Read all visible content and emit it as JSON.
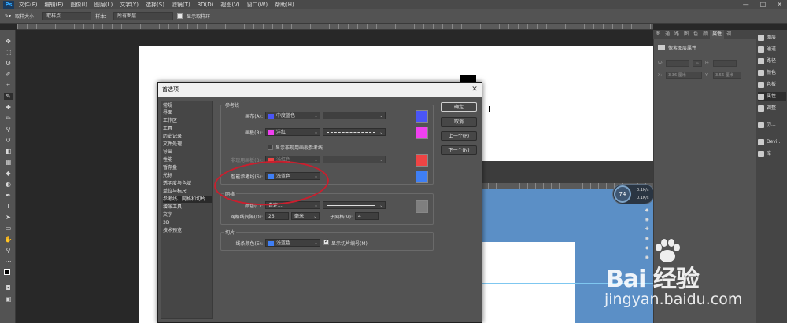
{
  "menubar": {
    "logo": "Ps",
    "items": [
      "文件(F)",
      "编辑(E)",
      "图像(I)",
      "图层(L)",
      "文字(Y)",
      "选择(S)",
      "滤镜(T)",
      "3D(D)",
      "视图(V)",
      "窗口(W)",
      "帮助(H)"
    ],
    "window_controls": [
      "—",
      "□",
      "✕"
    ]
  },
  "options": {
    "sample_size_label": "取样大小：",
    "sample_size_value": "取样点",
    "sample_label": "样本：",
    "sample_value": "所有图层",
    "show_ring_label": "显示取样环"
  },
  "properties_panel": {
    "tabs": [
      "图",
      "通",
      "路",
      "图",
      "色",
      "颜",
      "属性",
      "调"
    ],
    "active_tab": "属性",
    "header": "像素图层属性",
    "w_label": "W:",
    "h_label": "H:",
    "x_label": "X:",
    "y_label": "Y:",
    "x_value": "3.36 厘米",
    "y_value": "3.56 厘米",
    "link_glyph": "∞"
  },
  "dock": {
    "items": [
      {
        "icon": "layers-icon",
        "label": "图层"
      },
      {
        "icon": "channels-icon",
        "label": "通道"
      },
      {
        "icon": "paths-icon",
        "label": "路径"
      },
      {
        "icon": "color-icon",
        "label": "颜色"
      },
      {
        "icon": "swatches-icon",
        "label": "色板"
      },
      {
        "icon": "properties-icon",
        "label": "属性"
      },
      {
        "icon": "adjustments-icon",
        "label": "调整"
      },
      {
        "icon": "history-icon",
        "label": "历..."
      },
      {
        "icon": "device-icon",
        "label": "Devi..."
      },
      {
        "icon": "library-icon",
        "label": "库"
      }
    ]
  },
  "zoom_widget": {
    "value": "74",
    "line1": "0.1K/s",
    "line2": "0.1K/s"
  },
  "dialog": {
    "title": "首选项",
    "close": "✕",
    "categories": [
      "常规",
      "界面",
      "工作区",
      "工具",
      "历史记录",
      "文件处理",
      "导出",
      "性能",
      "暂存盘",
      "光标",
      "透明度与色域",
      "单位与标尺",
      "参考线、网格和切片",
      "增效工具",
      "文字",
      "3D",
      "技术预览"
    ],
    "selected_category": 12,
    "guides": {
      "group_label": "参考线",
      "canvas_label": "画布(A):",
      "canvas_color": "中度蓝色",
      "canvas_swatch": "#4a55f5",
      "artboard_label": "画板(R):",
      "artboard_color": "洋红",
      "artboard_swatch": "#f040f0",
      "show_inactive_label": "显示非现用画板参考线",
      "inactive_label": "非现用画板(B):",
      "inactive_color": "浅红色",
      "inactive_swatch": "#ee4444",
      "smart_label": "智能参考线(S):",
      "smart_color": "浅蓝色",
      "smart_swatch": "#3f7ff5"
    },
    "grid": {
      "group_label": "网格",
      "color_label": "颜色(C):",
      "color_value": "自定...",
      "color_swatch": "#7f7f7f",
      "spacing_label": "网格线间隔(D):",
      "spacing_value": "25",
      "unit_value": "毫米",
      "subdiv_label": "子网格(V):",
      "subdiv_value": "4"
    },
    "slices": {
      "group_label": "切片",
      "line_color_label": "线条颜色(E):",
      "line_color_value": "浅蓝色",
      "line_color_swatch": "#3f7ff5",
      "show_numbers_label": "显示切片编号(M)"
    },
    "buttons": {
      "ok": "确定",
      "cancel": "取消",
      "prev": "上一个(P)",
      "next": "下一个(N)"
    }
  },
  "watermark": {
    "brand": "Bai 经验",
    "url": "jingyan.baidu.com"
  }
}
